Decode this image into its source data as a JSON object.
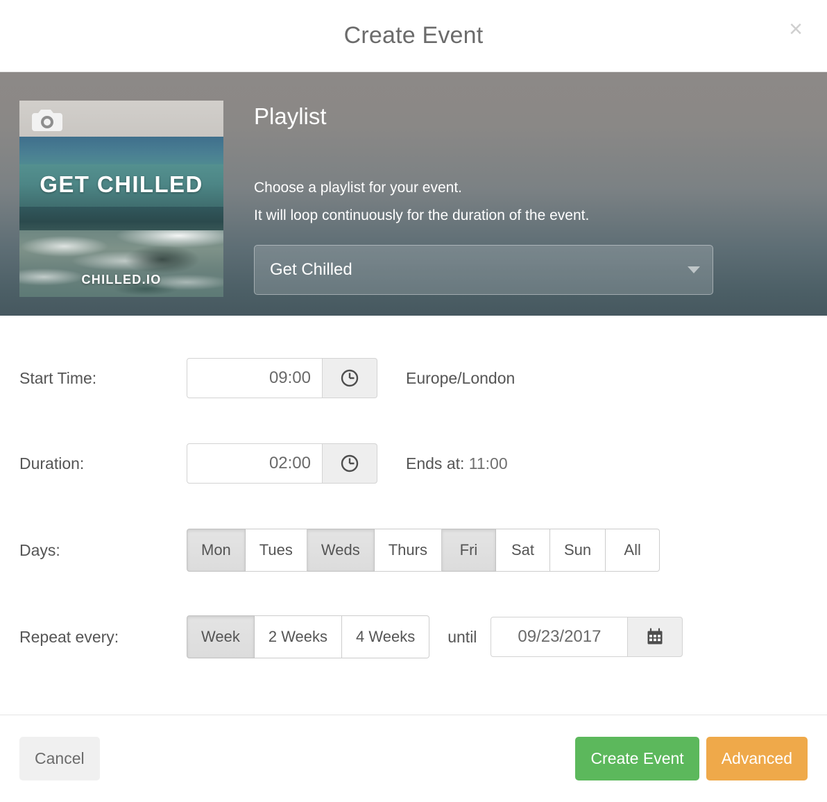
{
  "header": {
    "title": "Create Event",
    "close_label": "×"
  },
  "hero": {
    "heading": "Playlist",
    "description_line1": "Choose a playlist for your event.",
    "description_line2": "It will loop continuously for the duration of the event.",
    "playlist_select": {
      "selected": "Get Chilled",
      "caret": "dropdown-caret"
    },
    "artwork": {
      "title": "GET CHILLED",
      "footer": "CHILLED.IO",
      "camera_icon": "camera-icon"
    }
  },
  "form": {
    "start_time": {
      "label": "Start Time:",
      "value": "09:00",
      "icon": "clock-icon",
      "note": "Europe/London"
    },
    "duration": {
      "label": "Duration:",
      "value": "02:00",
      "icon": "clock-icon",
      "note_label": "Ends at:",
      "note_value": "11:00"
    },
    "days": {
      "label": "Days:",
      "options": [
        {
          "label": "Mon",
          "selected": true
        },
        {
          "label": "Tues",
          "selected": false
        },
        {
          "label": "Weds",
          "selected": true
        },
        {
          "label": "Thurs",
          "selected": false
        },
        {
          "label": "Fri",
          "selected": true
        },
        {
          "label": "Sat",
          "selected": false
        },
        {
          "label": "Sun",
          "selected": false
        },
        {
          "label": "All",
          "selected": false
        }
      ]
    },
    "repeat": {
      "label": "Repeat every:",
      "options": [
        {
          "label": "Week",
          "selected": true
        },
        {
          "label": "2 Weeks",
          "selected": false
        },
        {
          "label": "4 Weeks",
          "selected": false
        }
      ],
      "until_label": "until",
      "until_date": "09/23/2017",
      "calendar_icon": "calendar-icon"
    }
  },
  "footer": {
    "cancel_label": "Cancel",
    "create_label": "Create Event",
    "advanced_label": "Advanced"
  },
  "colors": {
    "create_button": "#5cb85c",
    "advanced_button": "#efa94a",
    "cancel_button": "#f0f0f0",
    "title_text": "#6b6b6b"
  }
}
